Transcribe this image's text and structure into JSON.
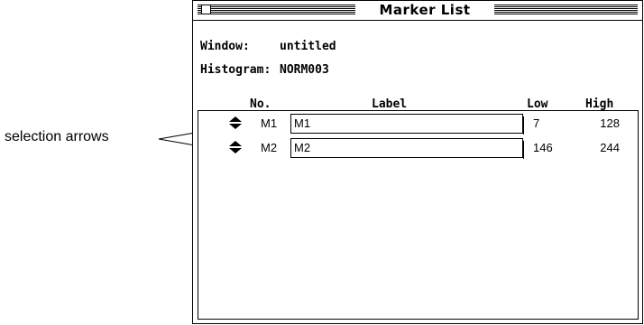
{
  "annotation": {
    "callout_label": "selection arrows"
  },
  "window": {
    "title": "Marker List",
    "info": {
      "window_label": "Window:",
      "window_value": "untitled",
      "histogram_label": "Histogram:",
      "histogram_value": "NORM003"
    },
    "columns": {
      "no": "No.",
      "label": "Label",
      "low": "Low",
      "high": "High"
    },
    "markers": [
      {
        "no": "M1",
        "label": "M1",
        "low": "7",
        "high": "128"
      },
      {
        "no": "M2",
        "label": "M2",
        "low": "146",
        "high": "244"
      }
    ]
  },
  "icons": {
    "close_box": "close-box-icon",
    "selection_arrows": "up-down-arrows-icon"
  }
}
